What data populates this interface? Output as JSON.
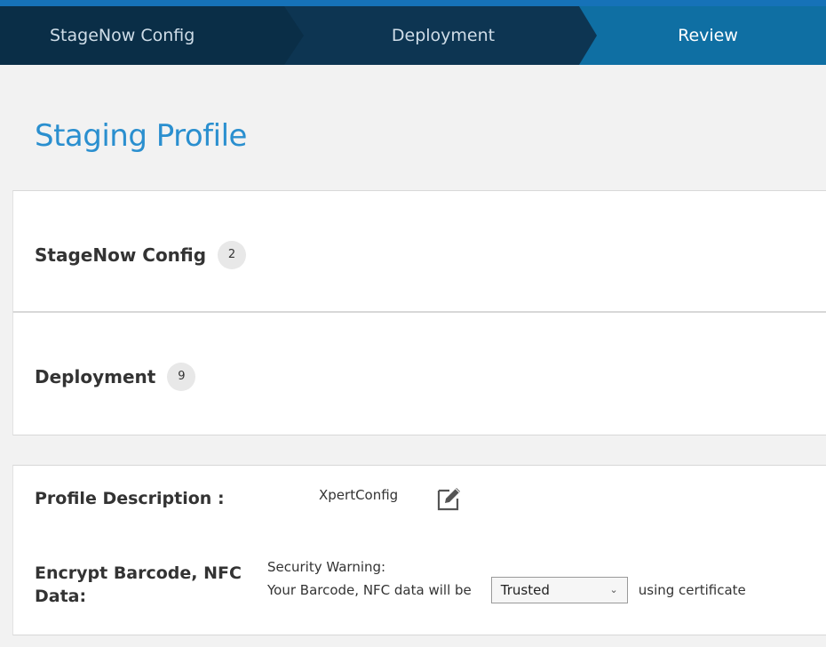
{
  "wizard": {
    "steps": [
      {
        "label": "StageNow Config",
        "active": false
      },
      {
        "label": "Deployment",
        "active": false
      },
      {
        "label": "Review",
        "active": true
      }
    ]
  },
  "page": {
    "title": "Staging Profile"
  },
  "sections": {
    "stagenow": {
      "title": "StageNow Config",
      "count": "2"
    },
    "deployment": {
      "title": "Deployment",
      "count": "9"
    }
  },
  "details": {
    "profile_description": {
      "label": "Profile Description :",
      "value": "XpertConfig",
      "icon": "edit-icon"
    },
    "encrypt": {
      "label": "Encrypt Barcode, NFC Data:",
      "warning_title": "Security Warning:",
      "warning_text": "Your Barcode, NFC data will be",
      "select_value": "Trusted",
      "suffix": "using certificate"
    }
  },
  "colors": {
    "accent": "#2a8fcf",
    "nav_dark": "#0d3552",
    "nav_active": "#0f6fa3"
  }
}
